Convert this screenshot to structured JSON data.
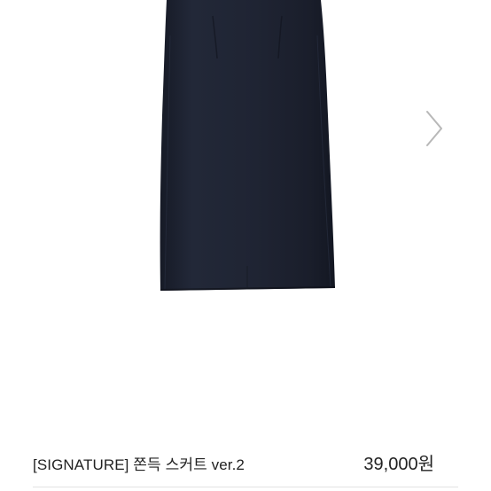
{
  "product": {
    "name": "[SIGNATURE] 쫀득 스커트 ver.2",
    "price": "39,000원"
  },
  "icons": {
    "next": "chevron-right-icon"
  },
  "colors": {
    "skirt": "#1f2433",
    "text": "#222222",
    "arrow": "#b8b8b8"
  }
}
